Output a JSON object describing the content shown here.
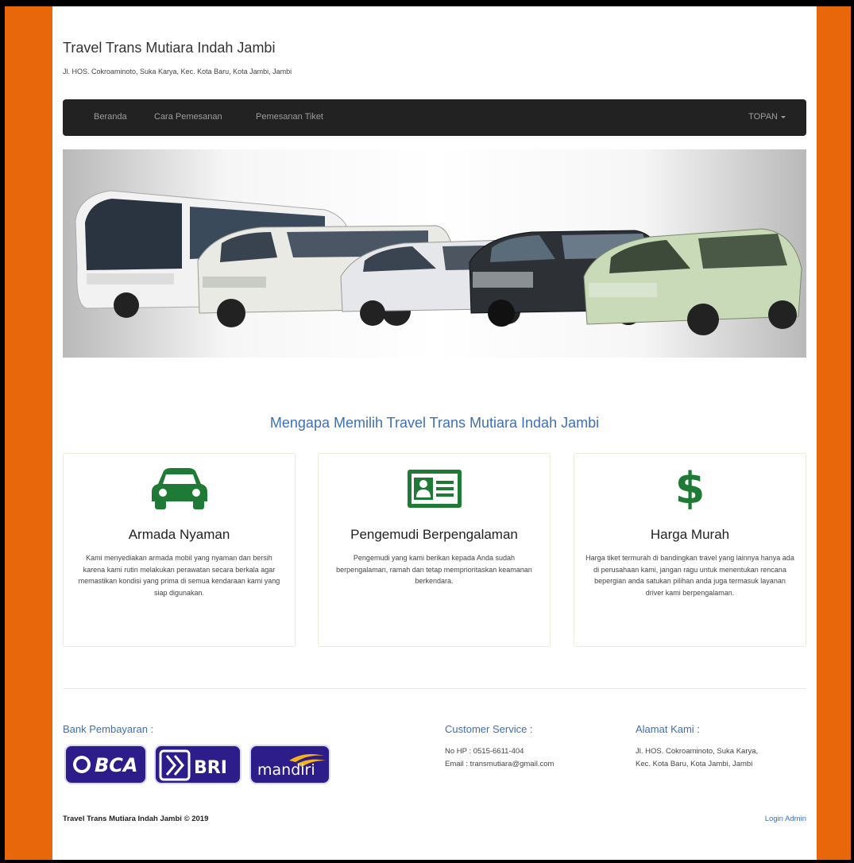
{
  "header": {
    "title": "Travel Trans Mutiara Indah Jambi",
    "address": "Jl. HOS. Cokroaminoto, Suka Karya, Kec. Kota Baru, Kota Jambi, Jambi"
  },
  "nav": {
    "items": [
      "Beranda",
      "Cara Pemesanan",
      "Pemesanan Tiket"
    ],
    "user": "TOPAN"
  },
  "section_title": "Mengapa Memilih Travel Trans Mutiara Indah Jambi",
  "features": [
    {
      "icon": "car-icon",
      "title": "Armada Nyaman",
      "text": "Kami menyediakan armada mobil yang nyaman dan bersih karena kami rutin melakukan perawatan secara berkala agar memastikan kondisi yang prima di semua kendaraan kami yang siap digunakan."
    },
    {
      "icon": "id-card-icon",
      "title": "Pengemudi Berpengalaman",
      "text": "Pengemudi yang kami berikan kepada Anda sudah berpengalaman, ramah dan tetap memprioritaskan keamanan berkendara."
    },
    {
      "icon": "dollar-icon",
      "title": "Harga Murah",
      "text": "Harga tiket termurah di bandingkan travel yang lainnya hanya ada di perusahaan kami, jangan ragu untuk menentukan rencana bepergian anda satukan pilihan anda juga termasuk layanan driver kami berpengalaman."
    }
  ],
  "footer": {
    "bank_heading": "Bank Pembayaran :",
    "banks": [
      "BCA",
      "BRI",
      "mandiri"
    ],
    "cs_heading": "Customer Service :",
    "cs_phone": "No HP : 0515-6611-404",
    "cs_email": "Email : transmutiara@gmail.com",
    "address_heading": "Alamat Kami :",
    "address_line1": "Jl. HOS. Cokroaminoto, Suka Karya,",
    "address_line2": "Kec. Kota Baru, Kota Jambi, Jambi",
    "copyright": "Travel Trans Mutiara Indah Jambi © 2019",
    "login_admin": "Login Admin"
  },
  "colors": {
    "accent": "#3f6fb5",
    "icon_green": "#1f7a35",
    "frame_orange": "#e8670a",
    "navbar": "#222222"
  }
}
